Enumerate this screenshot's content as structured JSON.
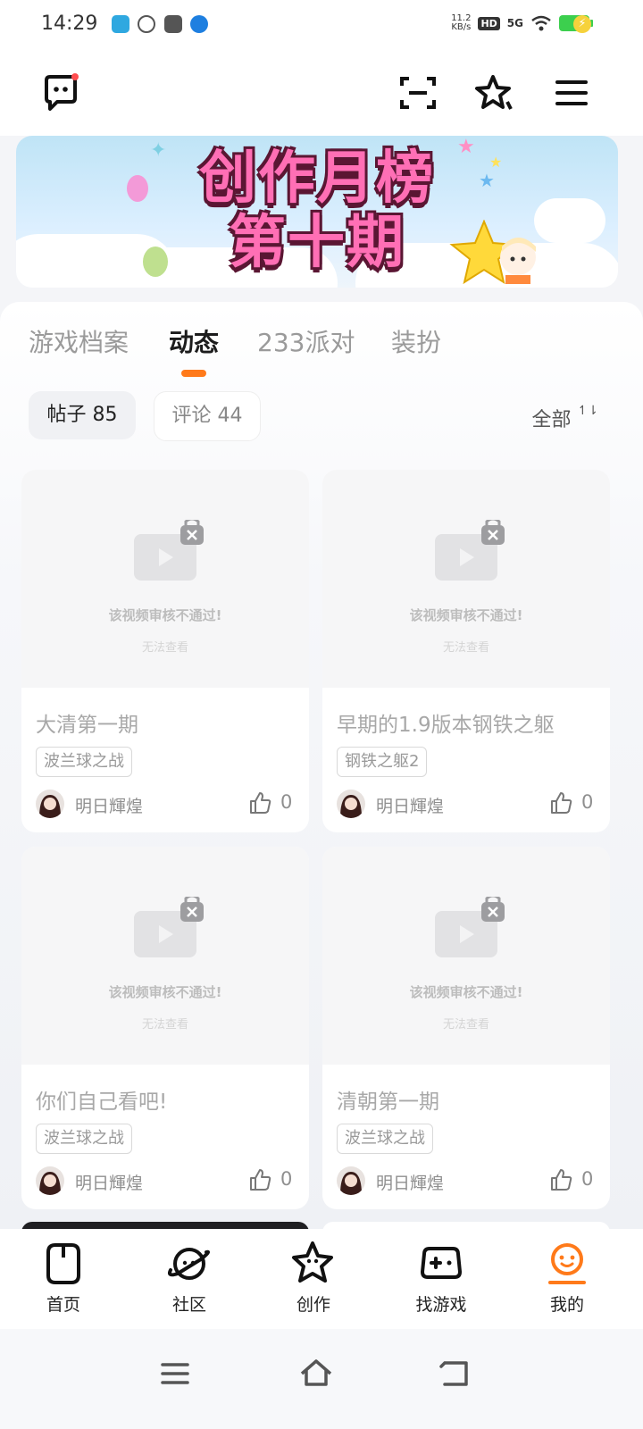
{
  "status_bar": {
    "time": "14:29",
    "net_speed_value": "11.2",
    "net_speed_unit": "KB/s",
    "hd_badge": "HD",
    "signal_label": "5G",
    "colors": {
      "battery": "#3ccf4e"
    }
  },
  "top_bar": {
    "icons": [
      "chat-bubble-icon",
      "scan-icon",
      "star-sparkle-icon",
      "menu-icon"
    ]
  },
  "banner": {
    "title_line1": "创作月榜",
    "title_line2": "第十期"
  },
  "tabs": [
    {
      "label": "游戏档案",
      "active": false
    },
    {
      "label": "动态",
      "active": true
    },
    {
      "label": "233派对",
      "active": false
    },
    {
      "label": "装扮",
      "active": false
    }
  ],
  "filters": {
    "posts": "帖子 85",
    "comments": "评论 44",
    "sort": "全部"
  },
  "video_notice": {
    "line1": "该视频审核不通过!",
    "line2": "无法查看"
  },
  "posts": [
    {
      "title": "大清第一期",
      "tag": "波兰球之战",
      "author": "明日輝煌",
      "likes": "0"
    },
    {
      "title": "早期的1.9版本钢铁之躯",
      "tag": "钢铁之躯2",
      "author": "明日輝煌",
      "likes": "0"
    },
    {
      "title": "你们自己看吧!",
      "tag": "波兰球之战",
      "author": "明日輝煌",
      "likes": "0"
    },
    {
      "title": "清朝第一期",
      "tag": "波兰球之战",
      "author": "明日輝煌",
      "likes": "0"
    }
  ],
  "bottom_nav": [
    {
      "label": "首页",
      "icon": "home-icon",
      "active": false
    },
    {
      "label": "社区",
      "icon": "planet-icon",
      "active": false
    },
    {
      "label": "创作",
      "icon": "star-create-icon",
      "active": false
    },
    {
      "label": "找游戏",
      "icon": "gamepad-icon",
      "active": false
    },
    {
      "label": "我的",
      "icon": "profile-icon",
      "active": true
    }
  ],
  "colors": {
    "accent": "#ff7a1a",
    "banner_text": "#ff6fb5"
  }
}
